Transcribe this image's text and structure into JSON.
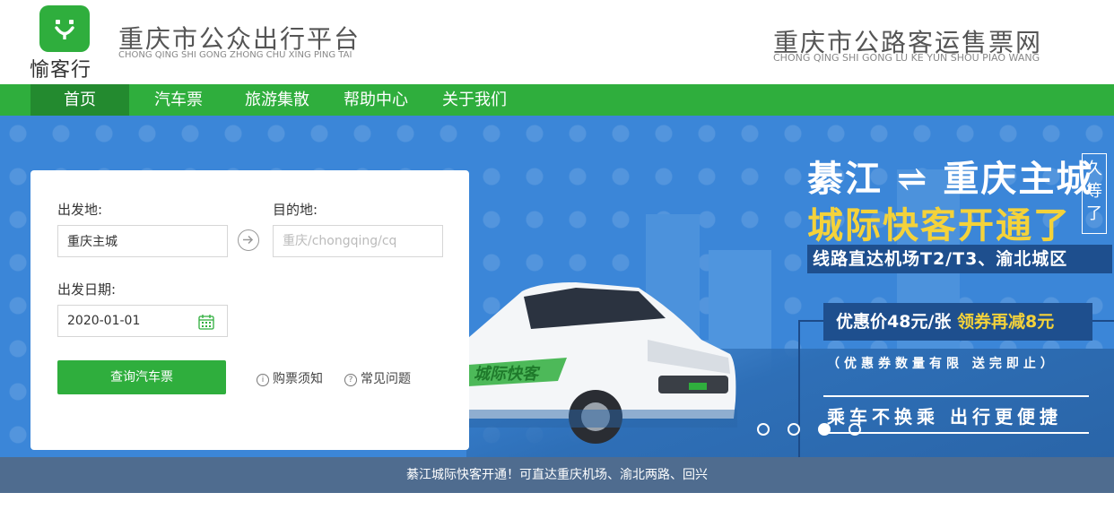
{
  "header": {
    "logo_text": "愉客行",
    "site_title": "重庆市公众出行平台",
    "site_subtitle": "CHONG QING SHI GONG ZHONG CHU XING PING TAI",
    "right_title": "重庆市公路客运售票网",
    "right_subtitle": "CHONG QING SHI GONG LU KE YUN SHOU PIAO WANG"
  },
  "nav": {
    "items": [
      "首页",
      "汽车票",
      "旅游集散",
      "帮助中心",
      "关于我们"
    ],
    "active_index": 0
  },
  "colors": {
    "brand_green": "#2fae3d",
    "banner_blue": "#3b86d8",
    "promo_yellow": "#f4d23a",
    "notice_bg": "#4f6c8f"
  },
  "banner": {
    "headline_1": "綦江 ⇌ 重庆主城",
    "headline_2": "城际快客开通了",
    "wait_tag": "久等了",
    "route_line": "线路直达机场T2/T3、渝北城区",
    "price_prefix": "优惠价48元/张 ",
    "price_highlight": "领券再减8元",
    "limit_text": "（优惠券数量有限 送完即止）",
    "slogan": "乘车不换乘  出行更便捷",
    "car_decal": "城际快客",
    "slide_count": 4,
    "active_slide": 3
  },
  "search": {
    "from_label": "出发地:",
    "from_value": "重庆主城",
    "to_label": "目的地:",
    "to_placeholder": "重庆/chongqing/cq",
    "date_label": "出发日期:",
    "date_value": "2020-01-01",
    "submit_label": "查询汽车票",
    "link_notice": "购票须知",
    "link_faq": "常见问题"
  },
  "notice": {
    "text": "綦江城际快客开通！可直达重庆机场、渝北两路、回兴"
  }
}
